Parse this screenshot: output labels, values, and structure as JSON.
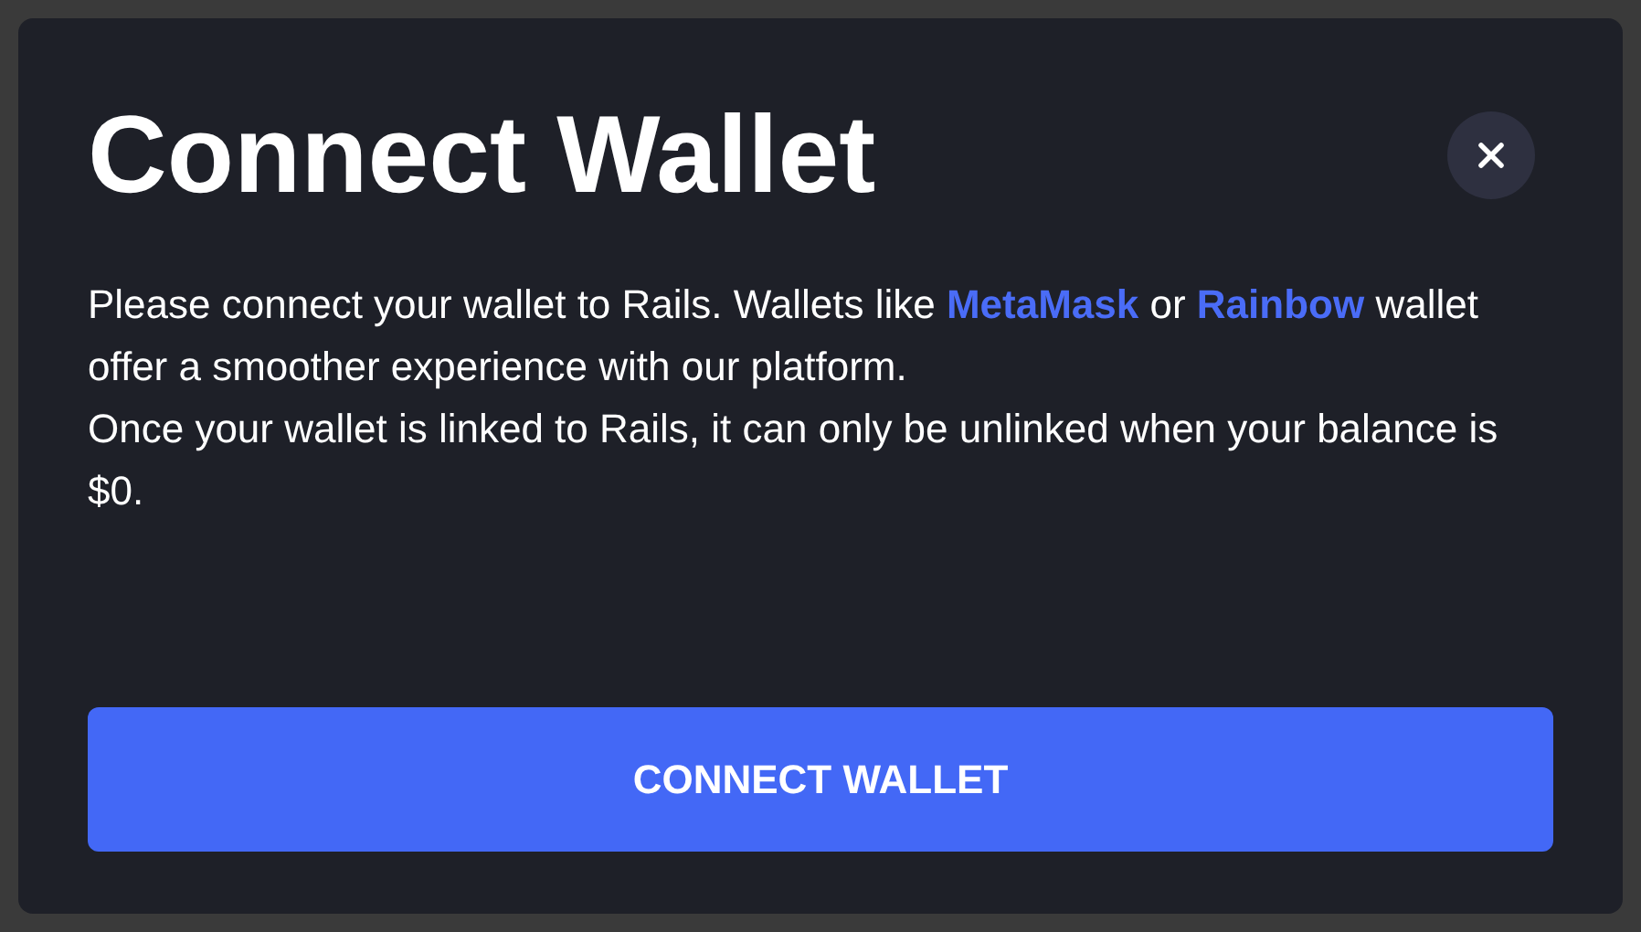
{
  "dialog": {
    "title": "Connect Wallet",
    "paragraphs": [
      [
        {
          "kind": "text",
          "text": "Please connect your wallet to Rails. Wallets like "
        },
        {
          "kind": "link",
          "text": "MetaMask"
        },
        {
          "kind": "text",
          "text": " or "
        },
        {
          "kind": "link",
          "text": "Rainbow"
        },
        {
          "kind": "text",
          "text": " wallet offer a smoother experience with our platform."
        }
      ],
      [
        {
          "kind": "text",
          "text": "Once your wallet is linked to Rails, it can only be unlinked when your balance is $0."
        }
      ]
    ],
    "button": "CONNECT WALLET"
  }
}
